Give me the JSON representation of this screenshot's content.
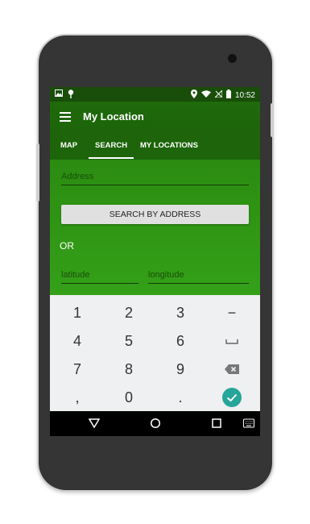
{
  "status": {
    "time": "10:52",
    "left_icons": [
      "image-icon",
      "pin-icon"
    ],
    "right_icons": [
      "location-icon",
      "wifi-icon",
      "signal-icon",
      "battery-icon"
    ]
  },
  "app": {
    "title": "My Location",
    "menu_icon": "hamburger-icon"
  },
  "tabs": [
    {
      "label": "MAP",
      "selected": false
    },
    {
      "label": "SEARCH",
      "selected": true
    },
    {
      "label": "MY LOCATIONS",
      "selected": false
    }
  ],
  "form": {
    "address_placeholder": "Address",
    "search_button": "SEARCH BY ADDRESS",
    "or_label": "OR",
    "latitude_placeholder": "latitude",
    "longitude_placeholder": "longitude"
  },
  "keyboard": {
    "keys": [
      [
        "1",
        "2",
        "3",
        "−"
      ],
      [
        "4",
        "5",
        "6",
        "␣"
      ],
      [
        "7",
        "8",
        "9",
        "⌫"
      ],
      [
        ",",
        "0",
        ".",
        "✓"
      ]
    ]
  },
  "colors": {
    "status_bar": "#184d0a",
    "toolbar": "#1d640a",
    "content": "#2b8c11",
    "accent_check": "#26a69a"
  },
  "nav": [
    "back-icon",
    "home-icon",
    "recents-icon",
    "keyboard-icon"
  ]
}
